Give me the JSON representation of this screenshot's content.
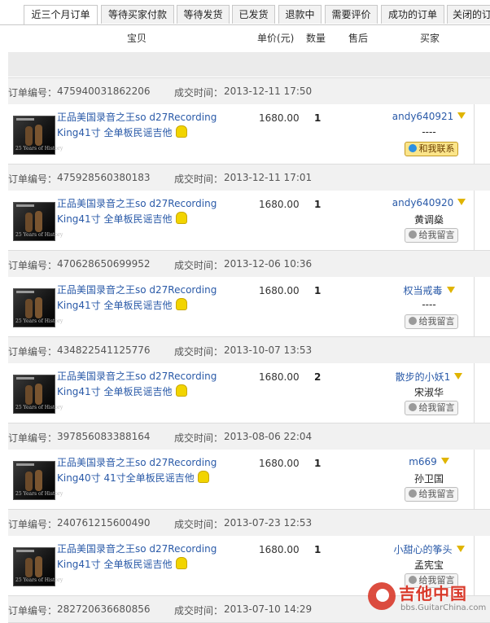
{
  "tabs": [
    {
      "label": "近三个月订单",
      "active": true
    },
    {
      "label": "等待买家付款",
      "active": false
    },
    {
      "label": "等待发货",
      "active": false
    },
    {
      "label": "已发货",
      "active": false
    },
    {
      "label": "退款中",
      "active": false
    },
    {
      "label": "需要评价",
      "active": false
    },
    {
      "label": "成功的订单",
      "active": false
    },
    {
      "label": "关闭的订",
      "active": false
    }
  ],
  "columns": {
    "item": "宝贝",
    "price": "单价(元)",
    "qty": "数量",
    "after_sale": "售后",
    "buyer": "买家"
  },
  "labels": {
    "order_no": "订单编号：",
    "deal_time": "成交时间："
  },
  "orders": [
    {
      "order_no": "475940031862206",
      "time": "2013-12-11 17:50",
      "title_line1": "正品美国录音之王so d27Recording",
      "title_line2": "King41寸 全单板民谣吉他",
      "price": "1680.00",
      "qty": "1",
      "buyer": "andy640921",
      "real_name": "----",
      "action": "和我联系",
      "action_type": "contact"
    },
    {
      "order_no": "475928560380183",
      "time": "2013-12-11 17:01",
      "title_line1": "正品美国录音之王so d27Recording",
      "title_line2": "King41寸 全单板民谣吉他",
      "price": "1680.00",
      "qty": "1",
      "buyer": "andy640920",
      "real_name": "黄调燊",
      "action": "给我留言",
      "action_type": "message"
    },
    {
      "order_no": "470628650699952",
      "time": "2013-12-06 10:36",
      "title_line1": "正品美国录音之王so d27Recording",
      "title_line2": "King41寸 全单板民谣吉他",
      "price": "1680.00",
      "qty": "1",
      "buyer": "权当戒毒",
      "real_name": "----",
      "action": "给我留言",
      "action_type": "message"
    },
    {
      "order_no": "434822541125776",
      "time": "2013-10-07 13:53",
      "title_line1": "正品美国录音之王so d27Recording",
      "title_line2": "King41寸 全单板民谣吉他",
      "price": "1680.00",
      "qty": "2",
      "buyer": "散步的小妖1",
      "real_name": "宋淑华",
      "action": "给我留言",
      "action_type": "message"
    },
    {
      "order_no": "397856083388164",
      "time": "2013-08-06 22:04",
      "title_line1": "正品美国录音之王so d27Recording",
      "title_line2": "King40寸 41寸全单板民谣吉他",
      "price": "1680.00",
      "qty": "1",
      "buyer": "m669",
      "real_name": "孙卫国",
      "action": "给我留言",
      "action_type": "message"
    },
    {
      "order_no": "240761215600490",
      "time": "2013-07-23 12:53",
      "title_line1": "正品美国录音之王so d27Recording",
      "title_line2": "King41寸 全单板民谣吉他",
      "price": "1680.00",
      "qty": "1",
      "buyer": "小甜心的筝头",
      "real_name": "孟宪宝",
      "action": "给我留言",
      "action_type": "message"
    }
  ],
  "last_order": {
    "order_no": "282720636680856",
    "time": "2013-07-10 14:29"
  },
  "thumb_caption": "25 Years of History",
  "watermark": {
    "title": "吉他中国",
    "url": "bbs.GuitarChina.com"
  },
  "colors": {
    "link": "#2a5aa8",
    "header_bg": "#f1f1f1",
    "contact_button": "#fbe58a",
    "watermark": "#d93a2b"
  }
}
